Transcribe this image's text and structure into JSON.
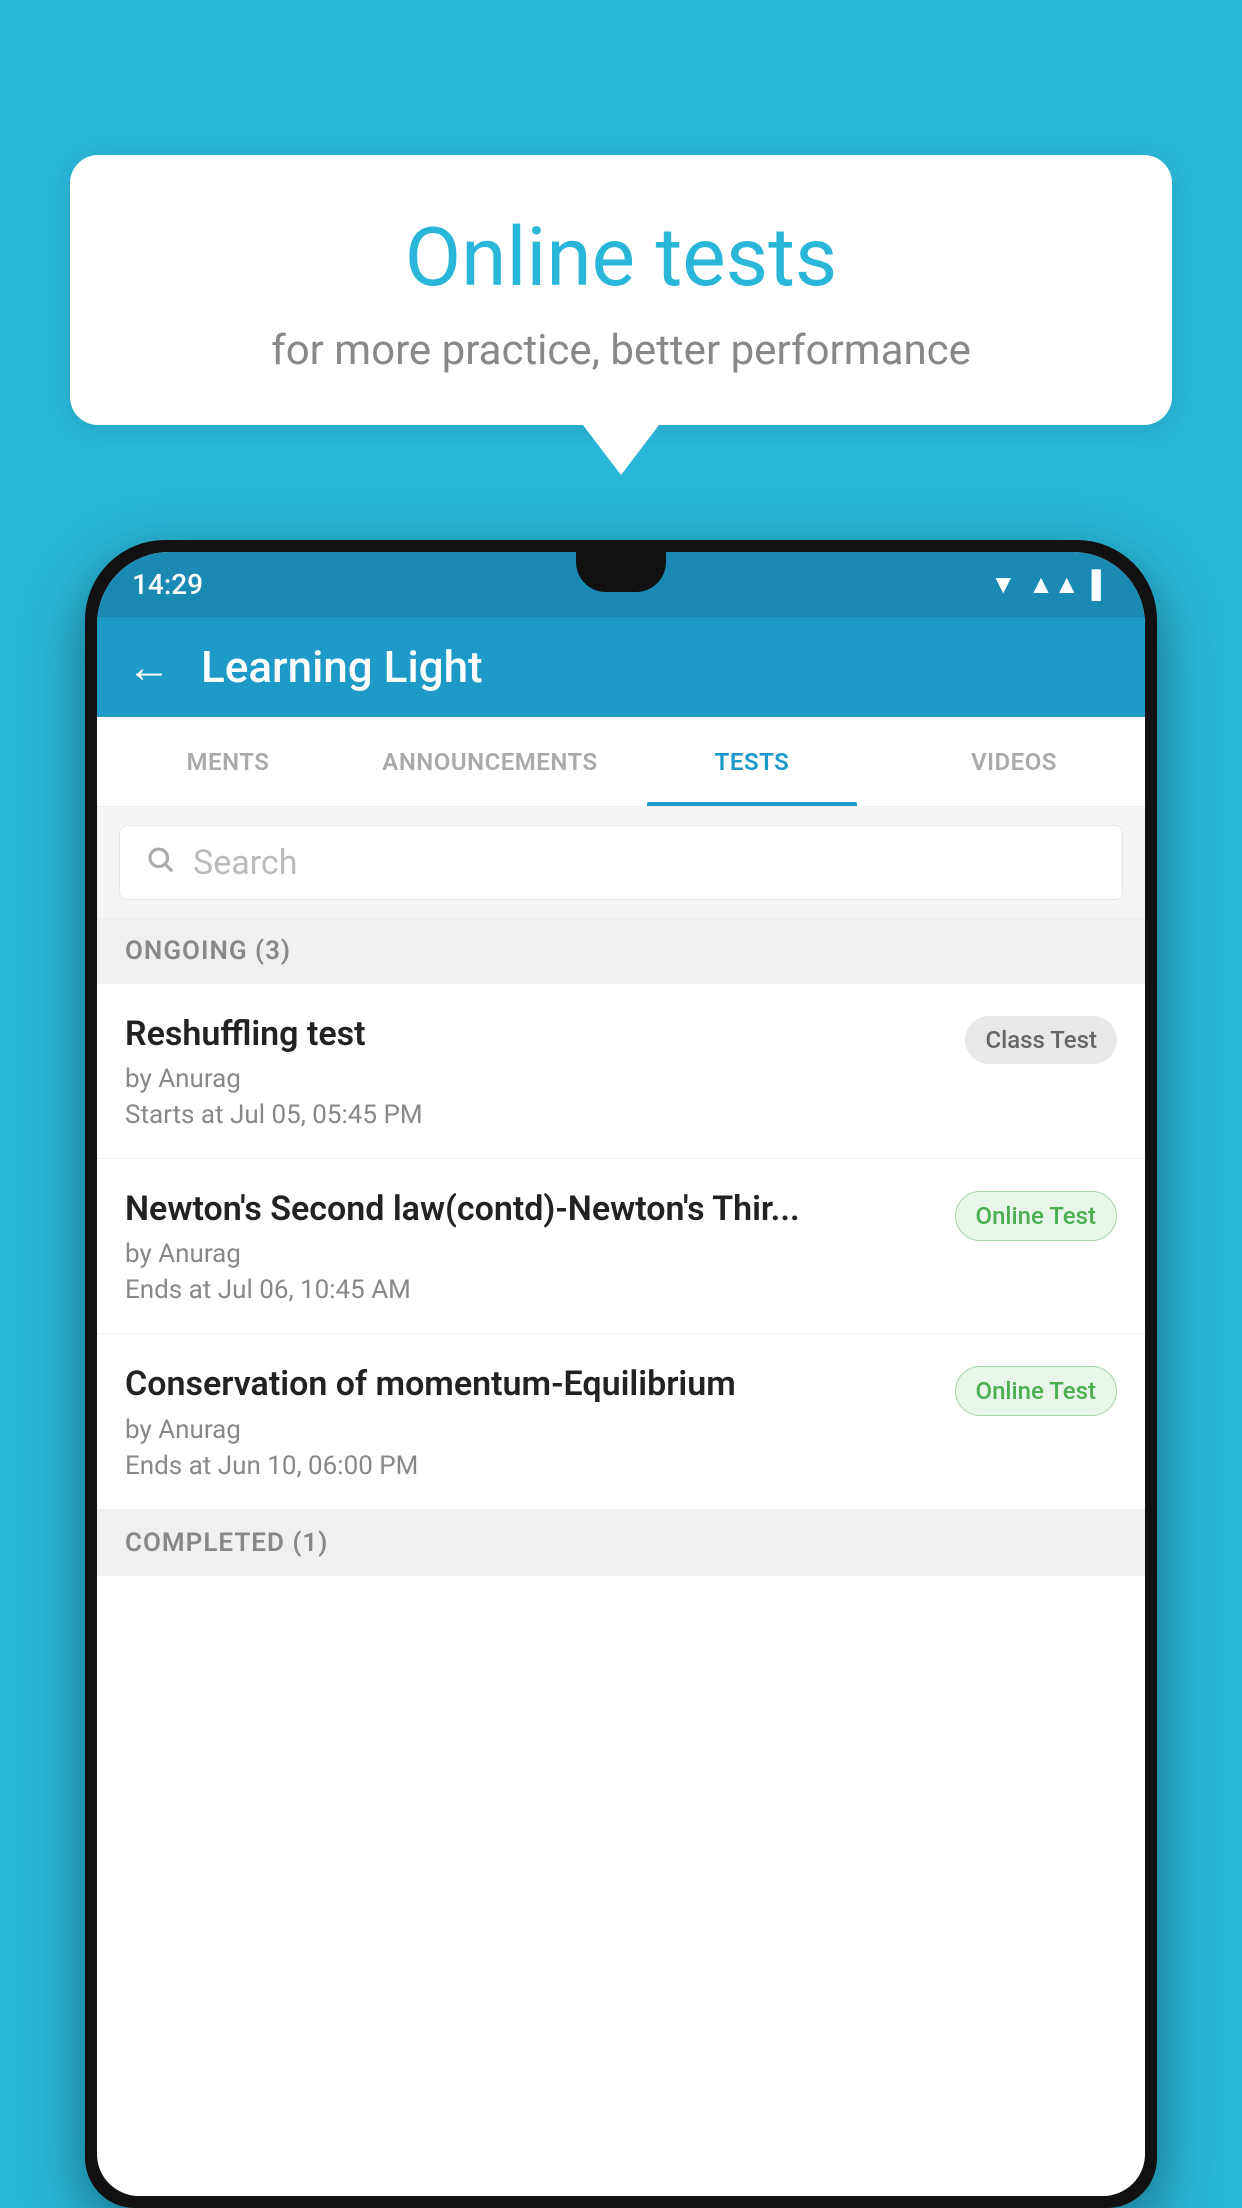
{
  "background_color": "#29b6d8",
  "speech_bubble": {
    "title": "Online tests",
    "subtitle": "for more practice, better performance"
  },
  "phone": {
    "status_bar": {
      "time": "14:29",
      "icons": [
        "wifi",
        "signal",
        "battery"
      ]
    },
    "app_header": {
      "back_label": "←",
      "title": "Learning Light"
    },
    "tabs": [
      {
        "label": "MENTS",
        "active": false
      },
      {
        "label": "ANNOUNCEMENTS",
        "active": false
      },
      {
        "label": "TESTS",
        "active": true
      },
      {
        "label": "VIDEOS",
        "active": false
      }
    ],
    "search": {
      "placeholder": "Search"
    },
    "sections": [
      {
        "label": "ONGOING (3)",
        "items": [
          {
            "name": "Reshuffling test",
            "author": "by Anurag",
            "time_label": "Starts at",
            "time": "Jul 05, 05:45 PM",
            "badge": "Class Test",
            "badge_type": "class"
          },
          {
            "name": "Newton's Second law(contd)-Newton's Thir...",
            "author": "by Anurag",
            "time_label": "Ends at",
            "time": "Jul 06, 10:45 AM",
            "badge": "Online Test",
            "badge_type": "online"
          },
          {
            "name": "Conservation of momentum-Equilibrium",
            "author": "by Anurag",
            "time_label": "Ends at",
            "time": "Jun 10, 06:00 PM",
            "badge": "Online Test",
            "badge_type": "online"
          }
        ]
      }
    ],
    "completed_section_label": "COMPLETED (1)"
  }
}
